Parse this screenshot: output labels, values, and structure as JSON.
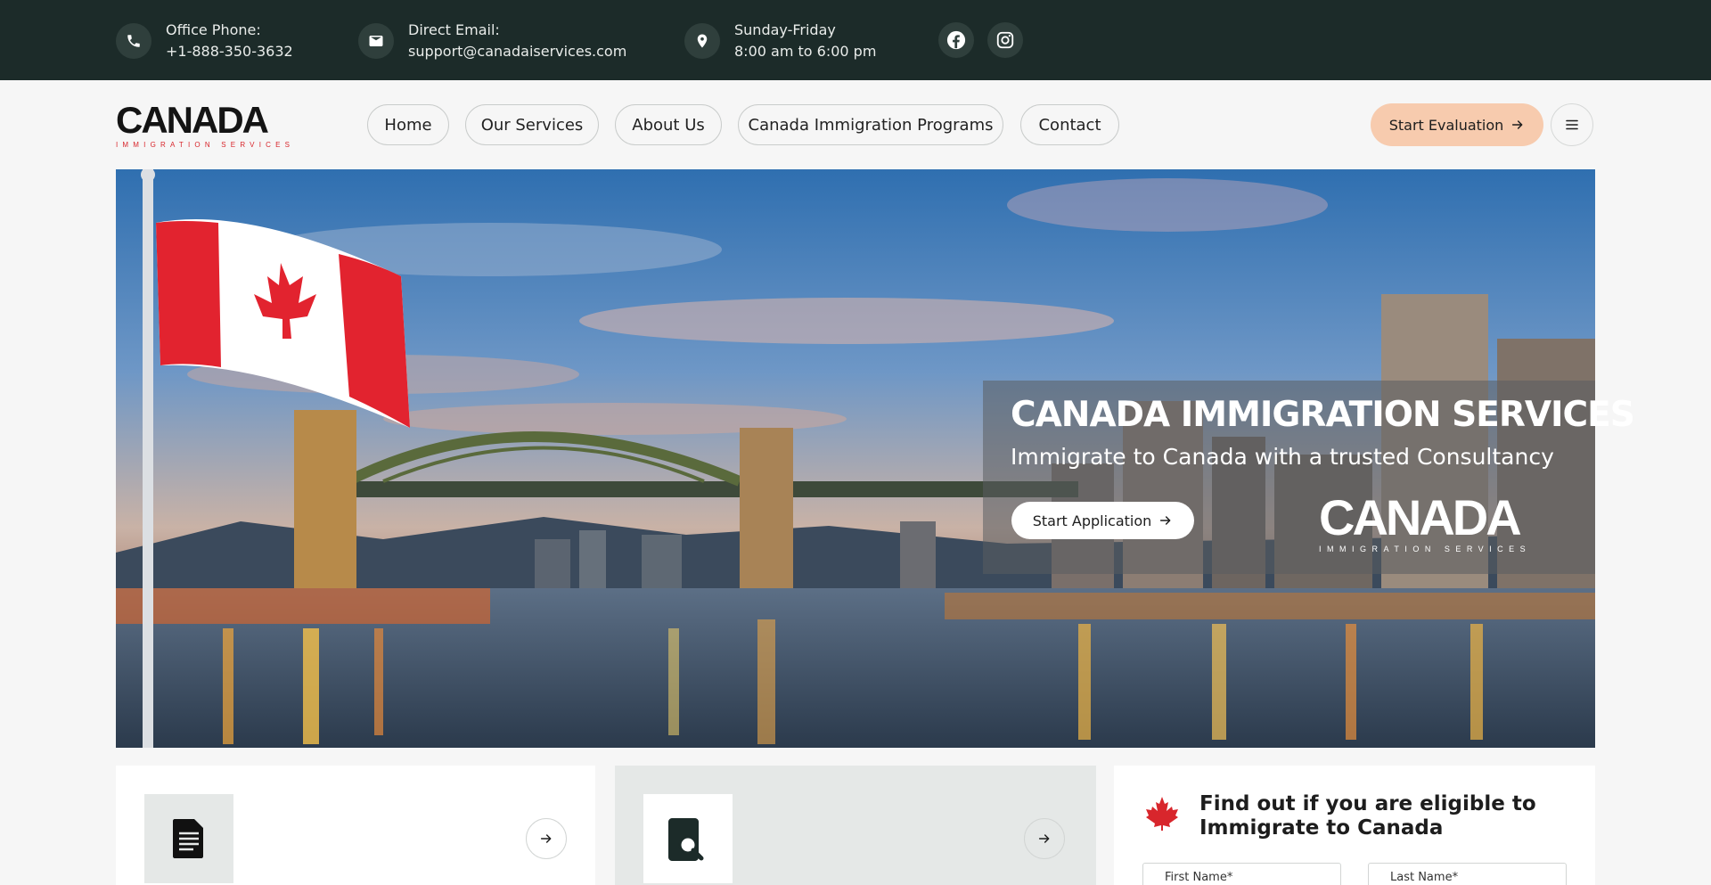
{
  "topbar": {
    "phone": {
      "label": "Office Phone:",
      "value": "+1-888-350-3632",
      "icon": "phone-icon"
    },
    "email": {
      "label": "Direct Email:",
      "value": "support@canadaiservices.com",
      "icon": "mail-icon"
    },
    "hours": {
      "label": "Sunday-Friday",
      "value": "8:00 am to 6:00 pm",
      "icon": "location-pin-icon"
    },
    "social": [
      "facebook-icon",
      "instagram-icon"
    ]
  },
  "header": {
    "logo": {
      "main": "CANADA",
      "sub": "IMMIGRATION SERVICES"
    },
    "nav": [
      "Home",
      "Our Services",
      "About Us",
      "Canada Immigration Programs",
      "Contact"
    ],
    "cta": "Start Evaluation",
    "menu_icon": "hamburger-icon"
  },
  "hero": {
    "title": "CANADA IMMIGRATION SERVICES",
    "subtitle": "Immigrate to Canada with a trusted Consultancy",
    "button": "Start Application",
    "logo": {
      "main": "CANADA",
      "sub": "IMMIGRATION SERVICES"
    }
  },
  "cards": {
    "eligibility": {
      "title": "Find out if you are eligible to Immigrate to Canada",
      "first_name": "First Name*",
      "last_name": "Last Name*"
    }
  },
  "colors": {
    "topbar_bg": "#1c2b29",
    "accent": "#f7cbae",
    "brand_red": "#d8262c"
  }
}
